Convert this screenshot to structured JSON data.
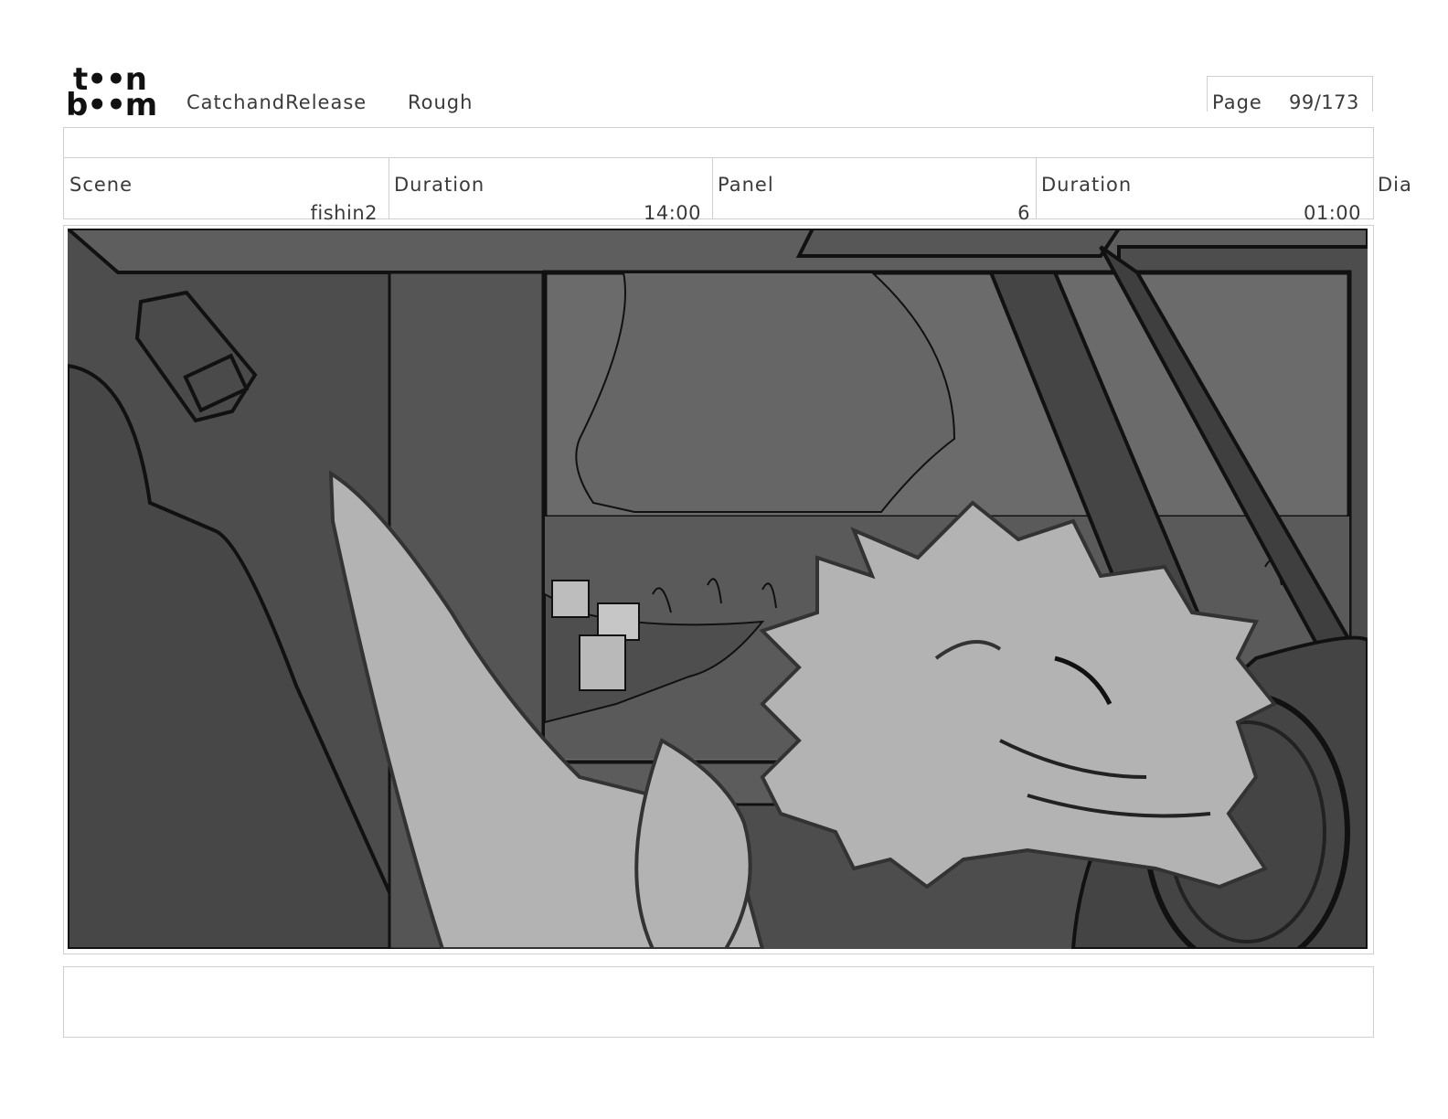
{
  "brand": {
    "logo_top": "t••n",
    "logo_bottom": "b••m",
    "logo_text": "toonboom"
  },
  "header": {
    "project": "CatchandRelease",
    "stage": "Rough",
    "page_label": "Page",
    "page_value": "99/173"
  },
  "info": {
    "scene_label": "Scene",
    "scene_value": "fishin2",
    "scene_duration_label": "Duration",
    "scene_duration_value": "14:00",
    "panel_label": "Panel",
    "panel_value": "6",
    "panel_duration_label": "Duration",
    "panel_duration_value": "01:00",
    "dialogue_label": "Dia"
  },
  "colors": {
    "panel_dark": "#4d4d4d",
    "panel_mid": "#6b6b6b",
    "character": "#b3b3b3",
    "line": "#111111"
  }
}
